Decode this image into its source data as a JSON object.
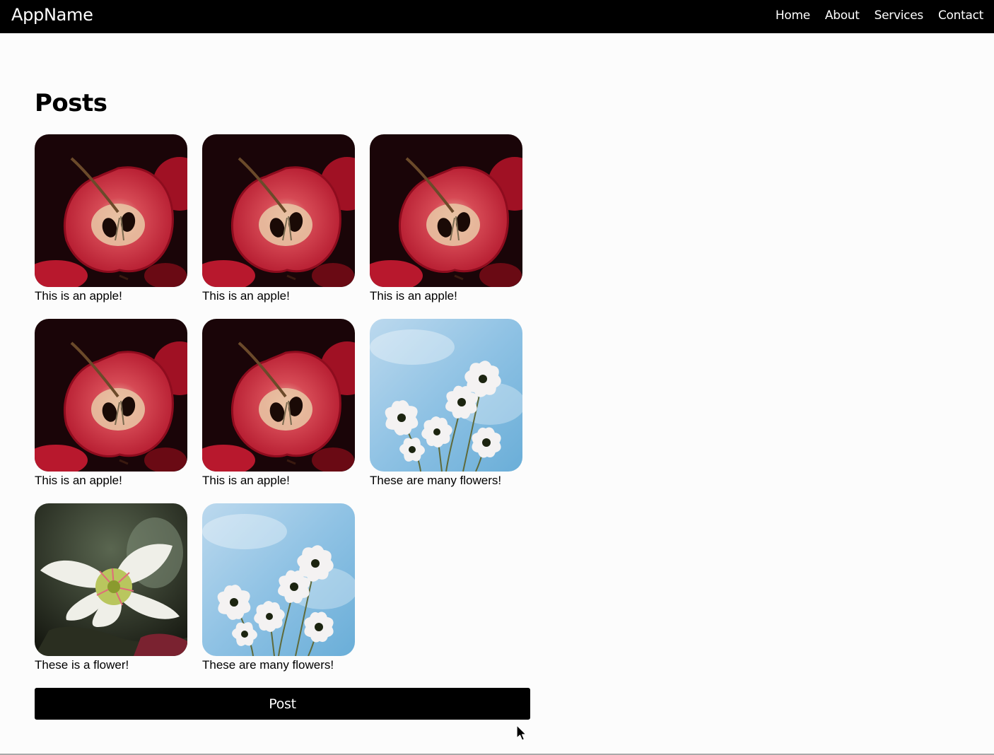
{
  "navbar": {
    "brand": "AppName",
    "links": [
      {
        "label": "Home"
      },
      {
        "label": "About"
      },
      {
        "label": "Services"
      },
      {
        "label": "Contact"
      }
    ]
  },
  "main": {
    "title": "Posts",
    "posts": [
      {
        "caption": "This is an apple!",
        "image": "apple-image"
      },
      {
        "caption": "This is an apple!",
        "image": "apple-image"
      },
      {
        "caption": "This is an apple!",
        "image": "apple-image"
      },
      {
        "caption": "This is an apple!",
        "image": "apple-image"
      },
      {
        "caption": "This is an apple!",
        "image": "apple-image"
      },
      {
        "caption": "These are many flowers!",
        "image": "flowers-image"
      },
      {
        "caption": "These is a flower!",
        "image": "flower-image"
      },
      {
        "caption": "These are many flowers!",
        "image": "flowers-image"
      }
    ],
    "post_button_label": "Post"
  },
  "colors": {
    "navbar_bg": "#000000",
    "page_bg": "#fcfcfc",
    "button_bg": "#000000"
  }
}
